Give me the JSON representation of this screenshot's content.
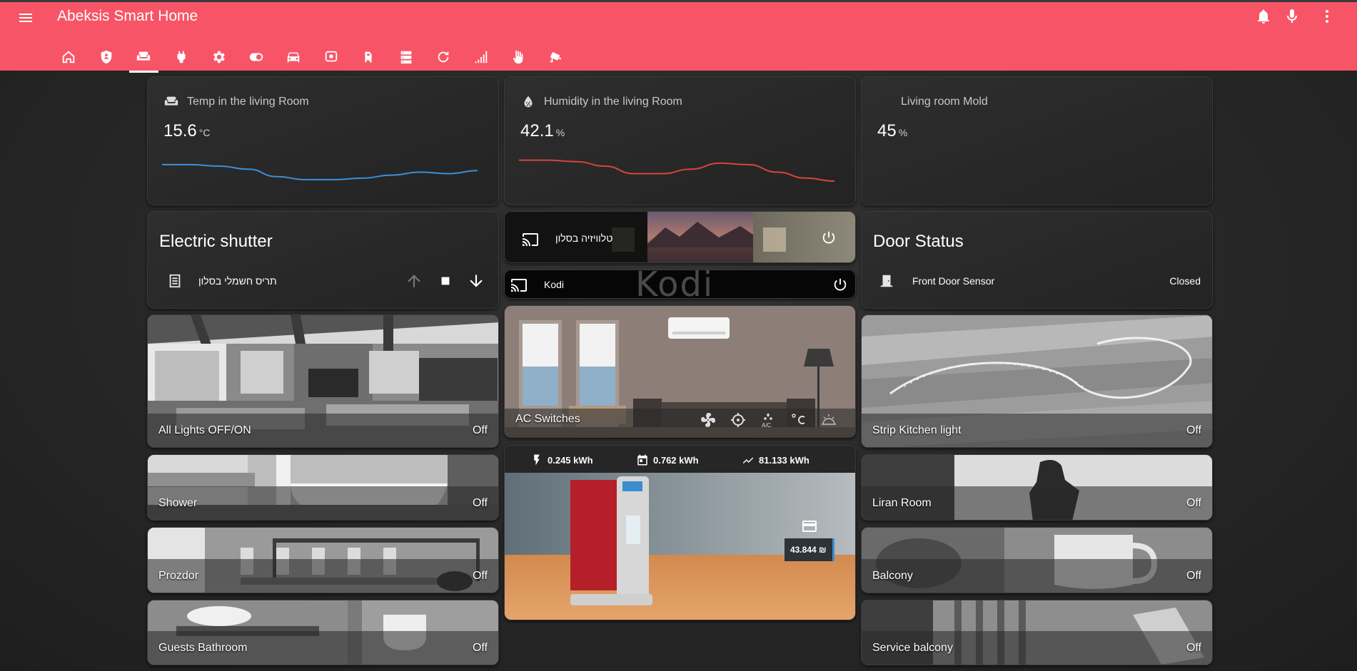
{
  "app": {
    "title": "Abeksis Smart Home"
  },
  "header": {
    "menu_icon": "menu-icon",
    "actions": [
      "bell-icon",
      "microphone-icon",
      "more-vertical-icon"
    ],
    "tabs": [
      "home-shield-icon",
      "security-icon",
      "sofa-icon",
      "plug-icon",
      "gear-icon",
      "toggle-icon",
      "car-icon",
      "cctv-icon",
      "robot-icon",
      "server-icon",
      "refresh-icon",
      "signal-icon",
      "hand-icon",
      "cctv-alt-icon"
    ],
    "active_tab": 2,
    "accent_color": "#f75567"
  },
  "sensors": [
    {
      "name": "Temp in the living Room",
      "value": "15.6",
      "unit": "°C",
      "icon": "sofa-icon",
      "line_color": "#3d8fd6",
      "trend": [
        0.45,
        0.45,
        0.5,
        0.6,
        0.85,
        0.95,
        0.95,
        0.9,
        0.8,
        0.7,
        0.75,
        0.65
      ]
    },
    {
      "name": "Humidity in the living Room",
      "value": "42.1",
      "unit": "%",
      "icon": "water-percent-icon",
      "line_color": "#d9433f",
      "trend": [
        0.3,
        0.3,
        0.35,
        0.5,
        0.75,
        0.75,
        0.6,
        0.4,
        0.45,
        0.7,
        0.9,
        1.0
      ]
    },
    {
      "name": "Living room Mold",
      "value": "45",
      "unit": "%"
    }
  ],
  "shutter": {
    "title": "Electric shutter",
    "entity": "תריס חשמלי בסלון",
    "icon": "window-shutter-icon",
    "controls": [
      "arrow-up-icon",
      "stop-icon",
      "arrow-down-icon"
    ]
  },
  "media": [
    {
      "name": "טלוויזיה בסלון",
      "icon": "cast-icon",
      "power": "power-icon"
    },
    {
      "name": "Kodi",
      "icon": "cast-icon",
      "power": "power-icon",
      "logo": "Kodi"
    }
  ],
  "door": {
    "title": "Door Status",
    "entity": "Front Door Sensor",
    "state": "Closed",
    "icon": "door-closed-icon"
  },
  "ac": {
    "label": "AC Switches",
    "icons": [
      "fan-icon",
      "target-icon",
      "ac-icon",
      "celsius-icon",
      "sun-snow-icon"
    ]
  },
  "lights_left": [
    {
      "label": "All Lights OFF/ON",
      "state": "Off"
    },
    {
      "label": "Shower",
      "state": "Off"
    },
    {
      "label": "Prozdor",
      "state": "Off"
    },
    {
      "label": "Guests Bathroom",
      "state": "Off"
    }
  ],
  "lights_right": [
    {
      "label": "Strip Kitchen light",
      "state": "Off"
    },
    {
      "label": "Liran Room",
      "state": "Off"
    },
    {
      "label": "Balcony",
      "state": "Off"
    },
    {
      "label": "Service balcony",
      "state": "Off"
    }
  ],
  "energy": {
    "today": "0.245 kWh",
    "month": "0.762 kWh",
    "total": "81.133 kWh",
    "cost": "43.844 ₪",
    "icons": [
      "flash-icon",
      "calendar-icon",
      "chart-line-icon",
      "credit-card-icon"
    ]
  }
}
